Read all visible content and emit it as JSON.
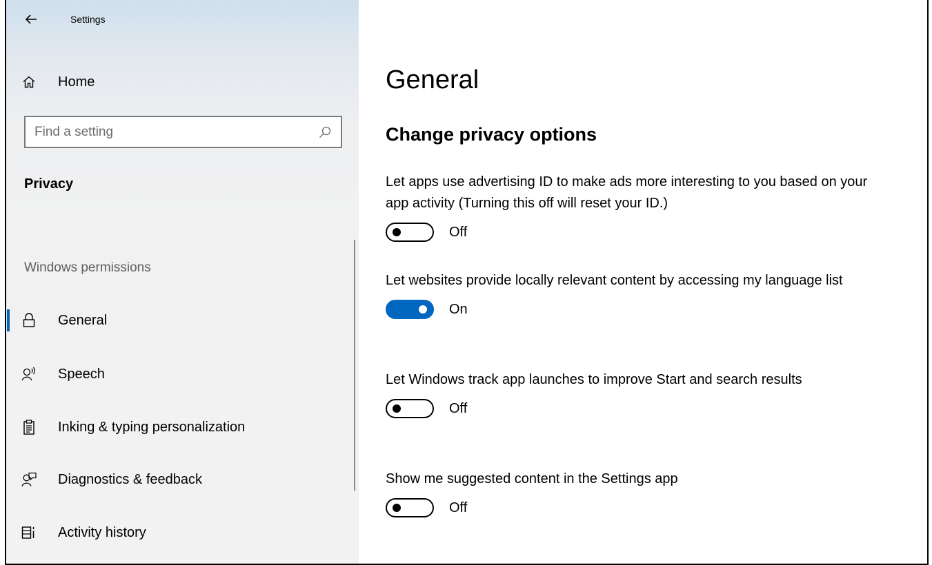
{
  "app": {
    "title": "Settings"
  },
  "sidebar": {
    "home_label": "Home",
    "search_placeholder": "Find a setting",
    "section_title": "Privacy",
    "group_header": "Windows permissions",
    "items": [
      {
        "label": "General",
        "icon": "lock-icon",
        "selected": true
      },
      {
        "label": "Speech",
        "icon": "speech-icon",
        "selected": false
      },
      {
        "label": "Inking & typing personalization",
        "icon": "clipboard-icon",
        "selected": false
      },
      {
        "label": "Diagnostics & feedback",
        "icon": "feedback-icon",
        "selected": false
      },
      {
        "label": "Activity history",
        "icon": "activity-icon",
        "selected": false
      }
    ]
  },
  "main": {
    "title": "General",
    "subtitle": "Change privacy options",
    "settings": [
      {
        "description": "Let apps use advertising ID to make ads more interesting to you based on your app activity (Turning this off will reset your ID.)",
        "state": "Off",
        "on": false
      },
      {
        "description": "Let websites provide locally relevant content by accessing my language list",
        "state": "On",
        "on": true
      },
      {
        "description": "Let Windows track app launches to improve Start and search results",
        "state": "Off",
        "on": false
      },
      {
        "description": "Show me suggested content in the Settings app",
        "state": "Off",
        "on": false
      }
    ]
  },
  "colors": {
    "accent": "#0067c0",
    "sidebar_bg": "#f2f2f2"
  }
}
